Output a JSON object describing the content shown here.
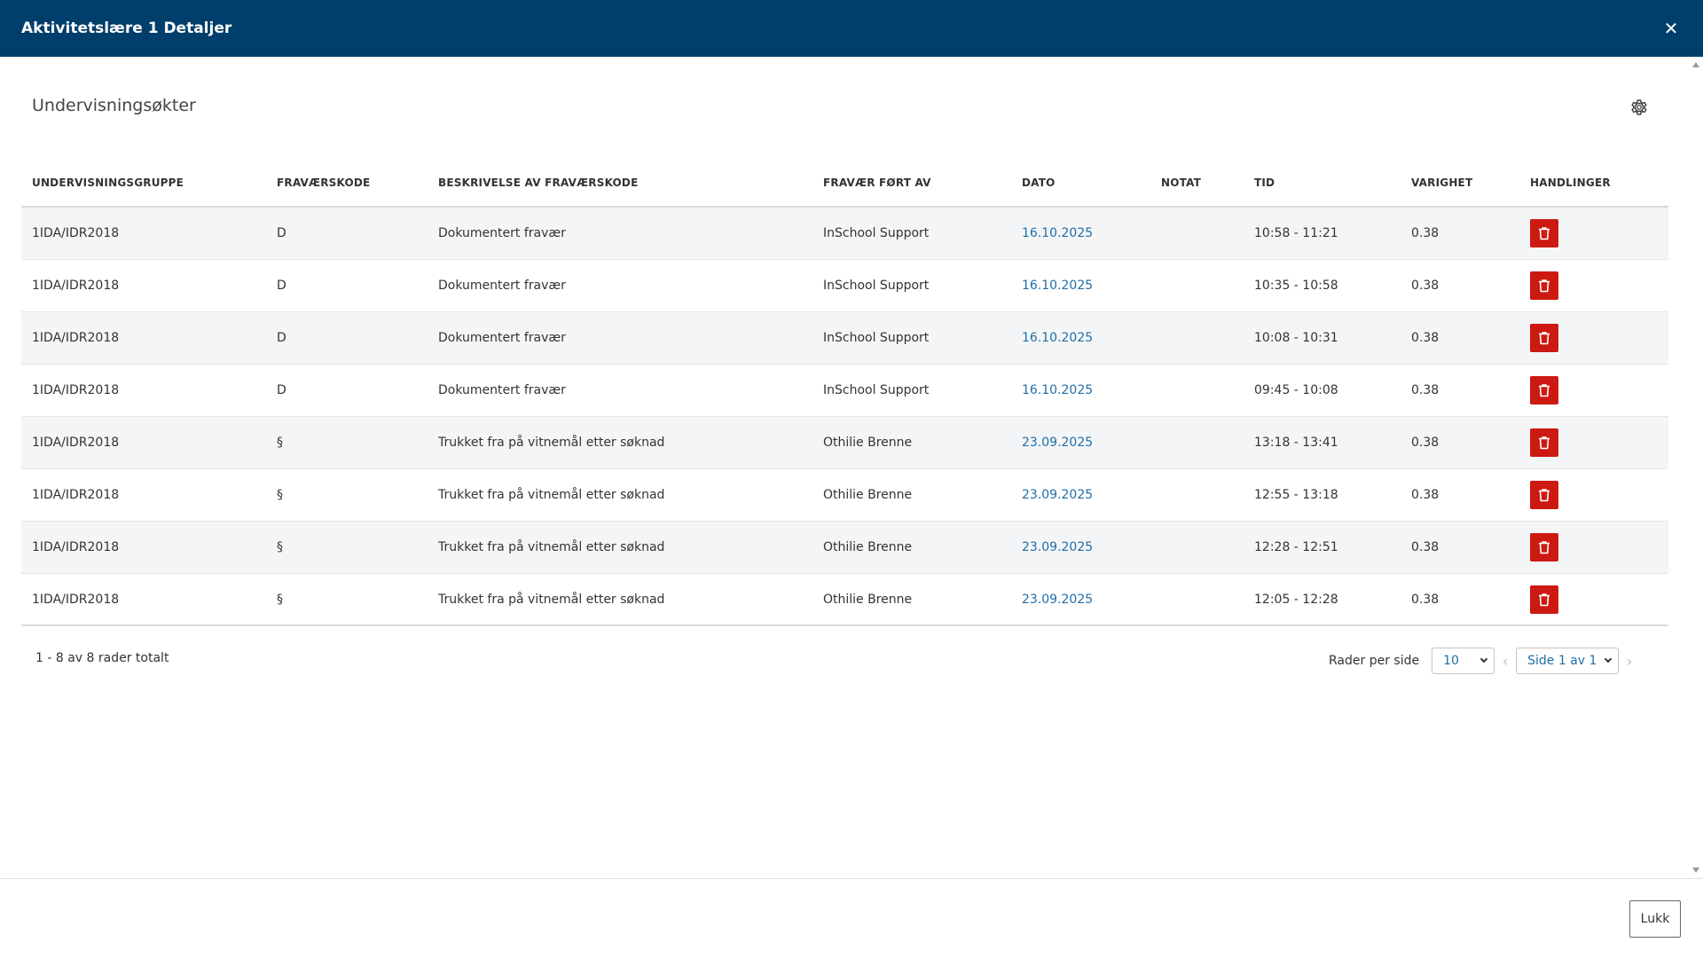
{
  "header": {
    "title": "Aktivitetslære 1 Detaljer",
    "close_symbol": "✕"
  },
  "section": {
    "title": "Undervisningsøkter"
  },
  "table": {
    "columns": [
      "UNDERVISNINGSGRUPPE",
      "FRAVÆRSKODE",
      "BESKRIVELSE AV FRAVÆRSKODE",
      "FRAVÆR FØRT AV",
      "DATO",
      "NOTAT",
      "TID",
      "VARIGHET",
      "HANDLINGER"
    ],
    "rows": [
      {
        "group": "1IDA/IDR2018",
        "code": "D",
        "description": "Dokumentert fravær",
        "by": "InSchool Support",
        "date": "16.10.2025",
        "note": "",
        "time": "10:58 - 11:21",
        "duration": "0.38"
      },
      {
        "group": "1IDA/IDR2018",
        "code": "D",
        "description": "Dokumentert fravær",
        "by": "InSchool Support",
        "date": "16.10.2025",
        "note": "",
        "time": "10:35 - 10:58",
        "duration": "0.38"
      },
      {
        "group": "1IDA/IDR2018",
        "code": "D",
        "description": "Dokumentert fravær",
        "by": "InSchool Support",
        "date": "16.10.2025",
        "note": "",
        "time": "10:08 - 10:31",
        "duration": "0.38"
      },
      {
        "group": "1IDA/IDR2018",
        "code": "D",
        "description": "Dokumentert fravær",
        "by": "InSchool Support",
        "date": "16.10.2025",
        "note": "",
        "time": "09:45 - 10:08",
        "duration": "0.38"
      },
      {
        "group": "1IDA/IDR2018",
        "code": "§",
        "description": "Trukket fra på vitnemål etter søknad",
        "by": "Othilie Brenne",
        "date": "23.09.2025",
        "note": "",
        "time": "13:18 - 13:41",
        "duration": "0.38"
      },
      {
        "group": "1IDA/IDR2018",
        "code": "§",
        "description": "Trukket fra på vitnemål etter søknad",
        "by": "Othilie Brenne",
        "date": "23.09.2025",
        "note": "",
        "time": "12:55 - 13:18",
        "duration": "0.38"
      },
      {
        "group": "1IDA/IDR2018",
        "code": "§",
        "description": "Trukket fra på vitnemål etter søknad",
        "by": "Othilie Brenne",
        "date": "23.09.2025",
        "note": "",
        "time": "12:28 - 12:51",
        "duration": "0.38"
      },
      {
        "group": "1IDA/IDR2018",
        "code": "§",
        "description": "Trukket fra på vitnemål etter søknad",
        "by": "Othilie Brenne",
        "date": "23.09.2025",
        "note": "",
        "time": "12:05 - 12:28",
        "duration": "0.38"
      }
    ]
  },
  "footer": {
    "summary": "1 - 8 av 8 rader totalt",
    "rows_per_page_label": "Rader per side",
    "rows_per_page_value": "10",
    "page_value": "Side 1 av 1",
    "prev_symbol": "‹",
    "next_symbol": "›"
  },
  "actions": {
    "close_label": "Lukk"
  },
  "colors": {
    "header_bg": "#003e6b",
    "delete_red": "#cc1a12",
    "link_blue": "#1f6ea8"
  },
  "icons": {
    "delete": "trash-icon",
    "settings": "gear-icon",
    "close": "close-icon"
  }
}
